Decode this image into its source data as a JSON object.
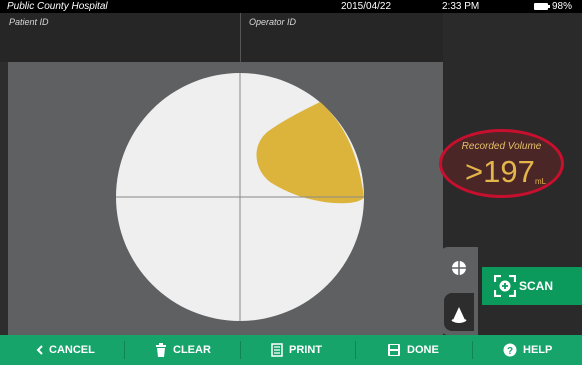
{
  "status": {
    "hospital": "Public County Hospital",
    "date": "2015/04/22",
    "time": "2:33 PM",
    "battery": "98%"
  },
  "fields": {
    "patient_label": "Patient ID",
    "operator_label": "Operator ID"
  },
  "volume": {
    "label": "Recorded Volume",
    "value": ">197",
    "unit": "mL"
  },
  "scan_button": {
    "label": "SCAN",
    "icon": "scan-bracket-plus-icon"
  },
  "tabs": [
    {
      "icon": "crosshair-icon"
    },
    {
      "icon": "ultrasound-probe-icon"
    }
  ],
  "actions": [
    {
      "label": "CANCEL",
      "icon": "chevron-left-icon"
    },
    {
      "label": "CLEAR",
      "icon": "trash-icon"
    },
    {
      "label": "PRINT",
      "icon": "print-icon"
    },
    {
      "label": "DONE",
      "icon": "save-icon"
    },
    {
      "label": "HELP",
      "icon": "help-icon"
    }
  ],
  "colors": {
    "accent_green": "#17a46b",
    "bladder_fill": "#dcb43c",
    "highlight_red": "#c8102e",
    "volume_text": "#e3b54a"
  }
}
